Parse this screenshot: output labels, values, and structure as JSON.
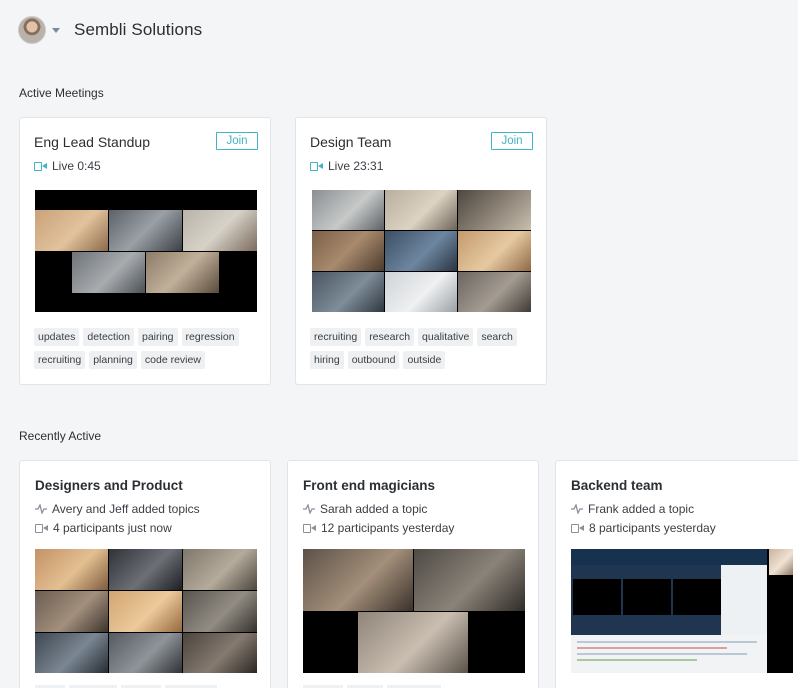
{
  "header": {
    "org_name": "Sembli Solutions"
  },
  "sections": {
    "active": "Active Meetings",
    "recent": "Recently Active"
  },
  "active_meetings": [
    {
      "title": "Eng Lead Standup",
      "join_label": "Join",
      "live_text": "Live 0:45",
      "tags": [
        "updates",
        "detection",
        "pairing",
        "regression",
        "recruiting",
        "planning",
        "code review"
      ]
    },
    {
      "title": "Design Team",
      "join_label": "Join",
      "live_text": "Live 23:31",
      "tags": [
        "recruiting",
        "research",
        "qualitative",
        "search",
        "hiring",
        "outbound",
        "outside"
      ]
    }
  ],
  "recent_meetings": [
    {
      "title": "Designers and Product",
      "activity": "Avery and Jeff added topics",
      "participants": "4 participants just now"
    },
    {
      "title": "Front end magicians",
      "activity": "Sarah added a topic",
      "participants": "12 participants yesterday"
    },
    {
      "title": "Backend team",
      "activity": "Frank added a topic",
      "participants": "8 participants yesterday"
    }
  ],
  "colors": {
    "accent": "#40b3c4",
    "background": "#f4f5f7",
    "card": "#ffffff",
    "tag_bg": "#eef0f2"
  }
}
